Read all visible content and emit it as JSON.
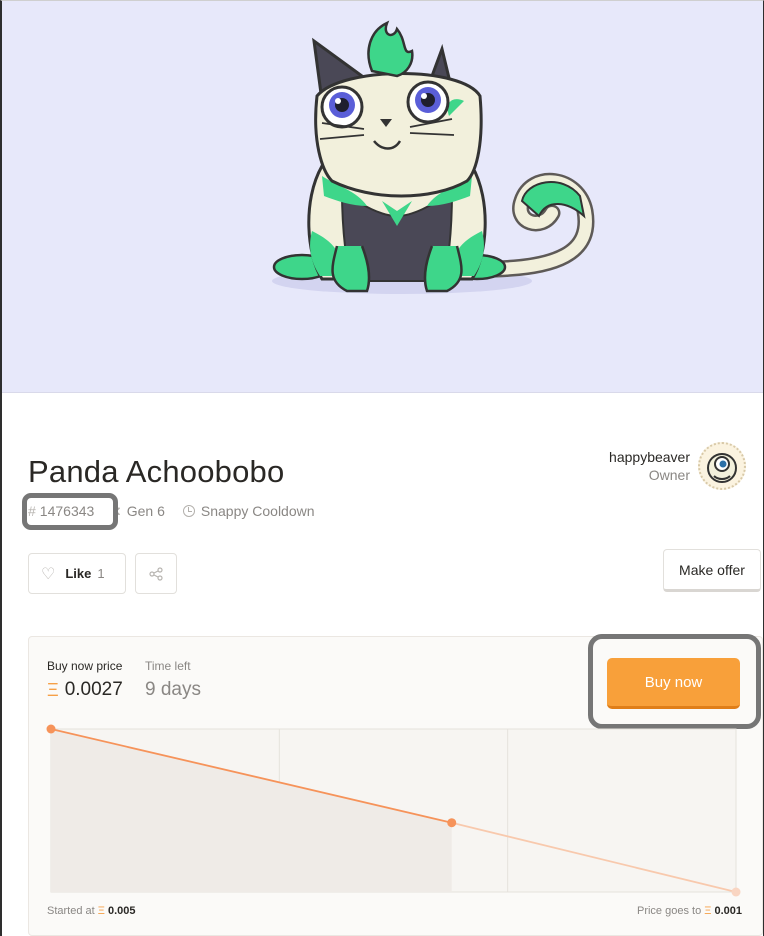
{
  "kitty": {
    "name": "Panda Achoobobo",
    "id": "1476343",
    "id_prefix": "#",
    "generation": "Gen 6",
    "cooldown": "Snappy Cooldown"
  },
  "owner": {
    "username": "happybeaver",
    "role": "Owner"
  },
  "actions": {
    "like_label": "Like",
    "like_count": "1",
    "make_offer_label": "Make offer",
    "buy_now_label": "Buy now"
  },
  "sale": {
    "buy_now_price_label": "Buy now price",
    "time_left_label": "Time left",
    "currency_symbol": "Ξ",
    "price": "0.0027",
    "time_left": "9 days",
    "started_at_label": "Started at",
    "started_at_value": "0.005",
    "price_goes_to_label": "Price goes to",
    "price_goes_to_value": "0.001"
  },
  "colors": {
    "hero_bg": "#e7e8fa",
    "accent_orange": "#f8a03a",
    "cat_green": "#3ed68a"
  },
  "chart_data": {
    "type": "line",
    "series": [
      {
        "values": [
          0.005,
          0.0027,
          0.001
        ]
      }
    ],
    "x": [
      0,
      0.585,
      1
    ],
    "ylim": [
      0.001,
      0.005
    ],
    "grid": true
  }
}
